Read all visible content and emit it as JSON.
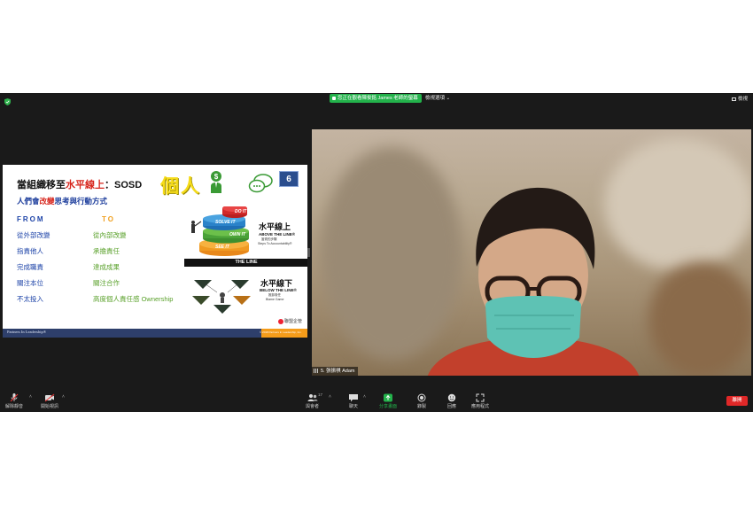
{
  "top_bar": {
    "share_notice": "您正在觀看陳俊銘 James 老師的螢幕",
    "view_options": "檢視選項 ⌄",
    "view_toggle": "檢視"
  },
  "slide": {
    "title_prefix": "當組織移至",
    "title_highlight": "水平線上",
    "title_suffix": "：SOSD",
    "person_label": "個人",
    "number_badge": "6",
    "subtitle_prefix": "人們會",
    "subtitle_highlight": "改變",
    "subtitle_suffix": "思考與行動方式",
    "from_label": "FROM",
    "to_label": "TO",
    "rows": [
      {
        "from": "從外部改變",
        "to": "從內部改變"
      },
      {
        "from": "指責他人",
        "to": "承擔責任"
      },
      {
        "from": "完成職責",
        "to": "達成成果"
      },
      {
        "from": "關注本位",
        "to": "關注合作"
      },
      {
        "from": "不太投入",
        "to": "高度個人責任感 Ownership"
      }
    ],
    "above_title": "水平線上",
    "above_english": "ABOVE THE LINE®",
    "above_chinese": "當責的步驟",
    "above_steps": "Steps To Accountability®",
    "steps": [
      "SOLVE IT",
      "DO IT",
      "OWN IT",
      "SEE IT"
    ],
    "the_line": "THE LINE",
    "below_title": "水平線下",
    "below_english": "BELOW THE LINE®",
    "below_chinese": "推卸責任",
    "below_game": "Blame Game",
    "logo_text": "聯盟企管",
    "footer_text": "Partners In Leadership®",
    "footer_copyright": "© 2018 Partners In Leadership, Inc."
  },
  "video": {
    "participant_name": "5. 張振祺 Adam"
  },
  "toolbar": {
    "unmute": "解除靜音",
    "start_video": "開始視訊",
    "participants": "與會者",
    "participants_count": "17",
    "chat": "聊天",
    "share_screen": "分享畫面",
    "record": "錄製",
    "reactions": "回應",
    "apps": "應用程式",
    "leave": "離開"
  },
  "colors": {
    "share_green": "#23b24b",
    "leave_red": "#e02828",
    "slide_blue": "#1e44a8",
    "slide_green": "#5aa12b",
    "slide_orange": "#f0a020",
    "title_red": "#d7261d"
  }
}
